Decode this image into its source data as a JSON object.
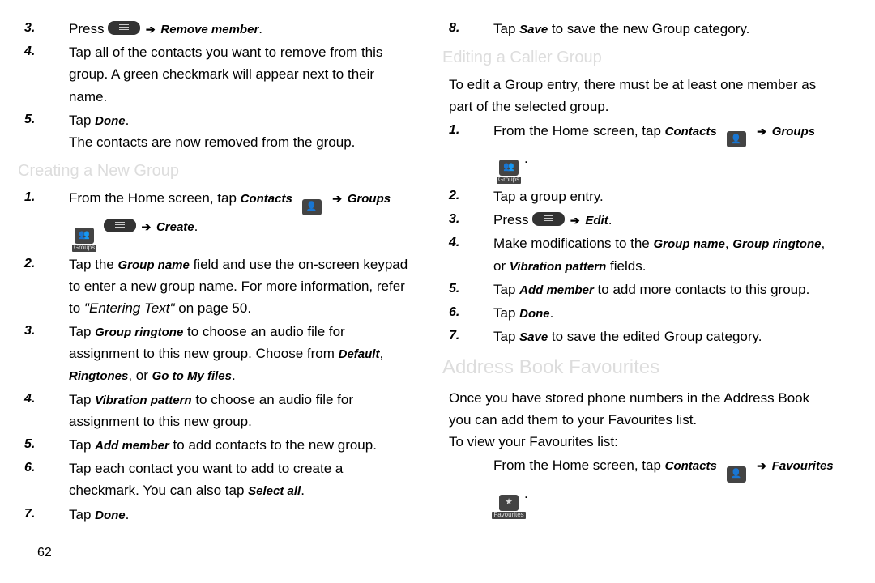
{
  "pageNumber": "62",
  "left": {
    "s3": {
      "num": "3.",
      "press": "Press ",
      "remove": "Remove member"
    },
    "s4": {
      "num": "4.",
      "t1": "Tap all of the contacts you want to remove from this",
      "t2": "group. A green checkmark will appear next to their",
      "t3": "name."
    },
    "s5": {
      "num": "5.",
      "tap": "Tap ",
      "done": "Done",
      "p": ".",
      "t2": "The contacts are now removed from the group."
    },
    "h1": "Creating a New Group",
    "c1": {
      "num": "1.",
      "t1a": "From the Home screen, tap ",
      "t1b": "Contacts",
      "t1arrow": "➔",
      "t1g": "Groups",
      "t2arrow": "➔",
      "t2create": "Create",
      "p": "."
    },
    "c2": {
      "num": "2.",
      "t1a": "Tap the ",
      "gn": "Group name",
      "t1b": " field and use the on-screen keypad",
      "t2": "to enter a new group name. For more information, refer",
      "t3a": "to ",
      "t3b": "\"Entering Text\" ",
      "t3c": "on page 50."
    },
    "c3": {
      "num": "3.",
      "t1a": "Tap ",
      "gr": "Group ringtone",
      "t1b": " to choose an audio file for",
      "t2a": "assignment to this new group. Choose from ",
      "def": "Default",
      "c": ",",
      "rtn": "Ringtones",
      "or": ", or ",
      "gmf": "Go to My files",
      "p": "."
    },
    "c4": {
      "num": "4.",
      "t1a": "Tap ",
      "vp": "Vibration pattern",
      "t1b": " to choose an audio file for",
      "t2": "assignment to this new group."
    },
    "c5": {
      "num": "5.",
      "t1a": "Tap ",
      "am": "Add member",
      "t1b": " to add contacts to the new group."
    },
    "c6": {
      "num": "6.",
      "t1": "Tap each contact you want to add to create a",
      "t2a": "checkmark. You can also tap ",
      "sa": "Select all",
      "p": "."
    },
    "c7": {
      "num": "7.",
      "tap": "Tap ",
      "done": "Done",
      "p": "."
    }
  },
  "right": {
    "s8": {
      "num": "8.",
      "tap": "Tap ",
      "save": "Save",
      "t": " to save the new Group category."
    },
    "h1": "Editing a Caller Group",
    "intro": {
      "t1": "To edit a Group entry, there must be at least one member as",
      "t2": "part of the selected group."
    },
    "e1": {
      "num": "1.",
      "t1a": "From the Home screen, tap ",
      "c": "Contacts",
      "arrow": "➔",
      "g": "Groups",
      "p": "."
    },
    "e2": {
      "num": "2.",
      "t": "Tap a group entry."
    },
    "e3": {
      "num": "3.",
      "press": "Press ",
      "arrow": "➔",
      "edit": "Edit",
      "p": "."
    },
    "e4": {
      "num": "4.",
      "t1a": "Make modifications to the ",
      "gn": "Group name",
      "c1": ", ",
      "gr": "Group ringtone",
      "c2": ",",
      "or": "or ",
      "vp": "Vibration pattern",
      "fields": " fields."
    },
    "e5": {
      "num": "5.",
      "tap": "Tap ",
      "am": "Add member",
      "t": " to add more contacts to this group."
    },
    "e6": {
      "num": "6.",
      "tap": "Tap ",
      "done": "Done",
      "p": "."
    },
    "e7": {
      "num": "7.",
      "tap": "Tap ",
      "save": "Save",
      "t": " to save the edited Group category."
    },
    "h2": "Address Book Favourites",
    "fav": {
      "t1": "Once you have stored phone numbers in the Address Book",
      "t2": "you can add them to your Favourites list.",
      "t3": "To view your Favourites list:"
    },
    "f1": {
      "t1a": "From the Home screen, tap ",
      "c": "Contacts",
      "arrow": "➔",
      "f": "Favourites",
      "p": "."
    }
  },
  "iconLabels": {
    "groups": "Groups",
    "favourites": "Favourites"
  }
}
